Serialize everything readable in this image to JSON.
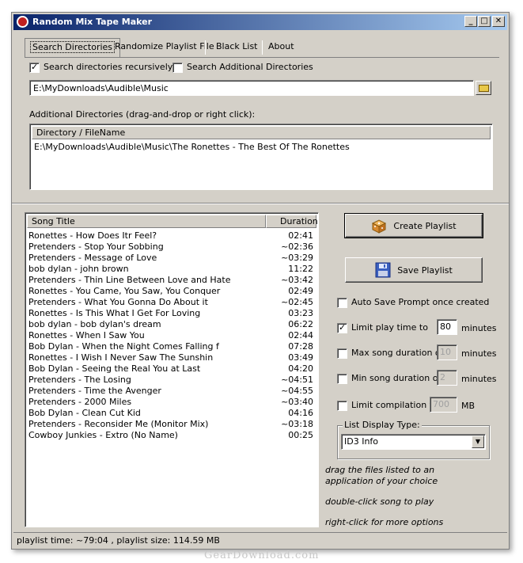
{
  "window": {
    "title": "Random Mix Tape Maker"
  },
  "tabs": [
    "Search Directories",
    "Randomize Playlist File",
    "Black List",
    "About"
  ],
  "search": {
    "recursive_label": "Search directories recursively",
    "recursive_checked": true,
    "additional_label": "Search Additional Directories",
    "additional_checked": false,
    "path_value": "E:\\MyDownloads\\Audible\\Music"
  },
  "additional": {
    "label": "Additional Directories (drag-and-drop or right click):",
    "column_header": "Directory / FileName",
    "items": [
      "E:\\MyDownloads\\Audible\\Music\\The Ronettes - The Best Of The Ronettes"
    ]
  },
  "songs": {
    "col_title": "Song Title",
    "col_duration": "Duration",
    "rows": [
      {
        "title": "Ronettes - How Does Itr Feel?",
        "duration": "02:41"
      },
      {
        "title": "Pretenders - Stop Your Sobbing",
        "duration": "~02:36"
      },
      {
        "title": "Pretenders - Message of Love",
        "duration": "~03:29"
      },
      {
        "title": "bob dylan - john brown",
        "duration": "11:22"
      },
      {
        "title": "Pretenders - Thin Line Between Love and Hate",
        "duration": "~03:42"
      },
      {
        "title": "Ronettes - You Came, You Saw, You Conquer",
        "duration": "02:49"
      },
      {
        "title": "Pretenders - What You Gonna Do About it",
        "duration": "~02:45"
      },
      {
        "title": "Ronettes - Is This What I Get For Loving",
        "duration": "03:23"
      },
      {
        "title": "bob dylan - bob dylan's dream",
        "duration": "06:22"
      },
      {
        "title": "Ronettes - When I Saw You",
        "duration": "02:44"
      },
      {
        "title": "Bob Dylan - When the Night Comes Falling f",
        "duration": "07:28"
      },
      {
        "title": "Ronettes - I Wish I Never Saw The Sunshin",
        "duration": "03:49"
      },
      {
        "title": "Bob Dylan - Seeing the Real You at Last",
        "duration": "04:20"
      },
      {
        "title": "Pretenders - The Losing",
        "duration": "~04:51"
      },
      {
        "title": "Pretenders - Time the Avenger",
        "duration": "~04:55"
      },
      {
        "title": "Pretenders - 2000 Miles",
        "duration": "~03:40"
      },
      {
        "title": "Bob Dylan - Clean Cut Kid",
        "duration": "04:16"
      },
      {
        "title": "Pretenders - Reconsider Me (Monitor Mix)",
        "duration": "~03:18"
      },
      {
        "title": "Cowboy Junkies - Extro (No Name)",
        "duration": "00:25"
      }
    ]
  },
  "actions": {
    "create_label": "Create Playlist",
    "save_label": "Save Playlist"
  },
  "options": {
    "auto_save_label": "Auto Save Prompt once created",
    "auto_save_checked": false,
    "limit_time_label": "Limit play time to",
    "limit_time_checked": true,
    "limit_time_value": "80",
    "limit_time_unit": "minutes",
    "max_song_label": "Max song duration of",
    "max_song_checked": false,
    "max_song_value": "10",
    "max_song_unit": "minutes",
    "min_song_label": "Min song duration of",
    "min_song_checked": false,
    "min_song_value": "2",
    "min_song_unit": "minutes",
    "limit_comp_label": "Limit compilation to",
    "limit_comp_checked": false,
    "limit_comp_value": "700",
    "limit_comp_unit": "MB"
  },
  "display": {
    "legend": "List Display Type:",
    "selected": "ID3 Info"
  },
  "hints": [
    "drag the files listed to an",
    "application of your choice",
    "double-click song to play",
    "right-click for more options"
  ],
  "status": "playlist time: ~79:04 , playlist size: 114.59 MB",
  "watermark": "GearDownload.com"
}
